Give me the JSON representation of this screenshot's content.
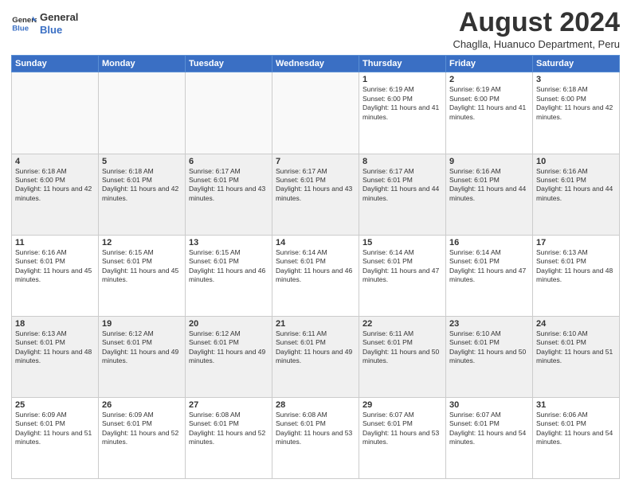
{
  "header": {
    "logo_line1": "General",
    "logo_line2": "Blue",
    "month_title": "August 2024",
    "location": "Chaglla, Huanuco Department, Peru"
  },
  "weekdays": [
    "Sunday",
    "Monday",
    "Tuesday",
    "Wednesday",
    "Thursday",
    "Friday",
    "Saturday"
  ],
  "rows": [
    [
      {
        "day": "",
        "sunrise": "",
        "sunset": "",
        "daylight": ""
      },
      {
        "day": "",
        "sunrise": "",
        "sunset": "",
        "daylight": ""
      },
      {
        "day": "",
        "sunrise": "",
        "sunset": "",
        "daylight": ""
      },
      {
        "day": "",
        "sunrise": "",
        "sunset": "",
        "daylight": ""
      },
      {
        "day": "1",
        "sunrise": "6:19 AM",
        "sunset": "6:00 PM",
        "daylight": "11 hours and 41 minutes."
      },
      {
        "day": "2",
        "sunrise": "6:19 AM",
        "sunset": "6:00 PM",
        "daylight": "11 hours and 41 minutes."
      },
      {
        "day": "3",
        "sunrise": "6:18 AM",
        "sunset": "6:00 PM",
        "daylight": "11 hours and 42 minutes."
      }
    ],
    [
      {
        "day": "4",
        "sunrise": "6:18 AM",
        "sunset": "6:00 PM",
        "daylight": "11 hours and 42 minutes."
      },
      {
        "day": "5",
        "sunrise": "6:18 AM",
        "sunset": "6:01 PM",
        "daylight": "11 hours and 42 minutes."
      },
      {
        "day": "6",
        "sunrise": "6:17 AM",
        "sunset": "6:01 PM",
        "daylight": "11 hours and 43 minutes."
      },
      {
        "day": "7",
        "sunrise": "6:17 AM",
        "sunset": "6:01 PM",
        "daylight": "11 hours and 43 minutes."
      },
      {
        "day": "8",
        "sunrise": "6:17 AM",
        "sunset": "6:01 PM",
        "daylight": "11 hours and 44 minutes."
      },
      {
        "day": "9",
        "sunrise": "6:16 AM",
        "sunset": "6:01 PM",
        "daylight": "11 hours and 44 minutes."
      },
      {
        "day": "10",
        "sunrise": "6:16 AM",
        "sunset": "6:01 PM",
        "daylight": "11 hours and 44 minutes."
      }
    ],
    [
      {
        "day": "11",
        "sunrise": "6:16 AM",
        "sunset": "6:01 PM",
        "daylight": "11 hours and 45 minutes."
      },
      {
        "day": "12",
        "sunrise": "6:15 AM",
        "sunset": "6:01 PM",
        "daylight": "11 hours and 45 minutes."
      },
      {
        "day": "13",
        "sunrise": "6:15 AM",
        "sunset": "6:01 PM",
        "daylight": "11 hours and 46 minutes."
      },
      {
        "day": "14",
        "sunrise": "6:14 AM",
        "sunset": "6:01 PM",
        "daylight": "11 hours and 46 minutes."
      },
      {
        "day": "15",
        "sunrise": "6:14 AM",
        "sunset": "6:01 PM",
        "daylight": "11 hours and 47 minutes."
      },
      {
        "day": "16",
        "sunrise": "6:14 AM",
        "sunset": "6:01 PM",
        "daylight": "11 hours and 47 minutes."
      },
      {
        "day": "17",
        "sunrise": "6:13 AM",
        "sunset": "6:01 PM",
        "daylight": "11 hours and 48 minutes."
      }
    ],
    [
      {
        "day": "18",
        "sunrise": "6:13 AM",
        "sunset": "6:01 PM",
        "daylight": "11 hours and 48 minutes."
      },
      {
        "day": "19",
        "sunrise": "6:12 AM",
        "sunset": "6:01 PM",
        "daylight": "11 hours and 49 minutes."
      },
      {
        "day": "20",
        "sunrise": "6:12 AM",
        "sunset": "6:01 PM",
        "daylight": "11 hours and 49 minutes."
      },
      {
        "day": "21",
        "sunrise": "6:11 AM",
        "sunset": "6:01 PM",
        "daylight": "11 hours and 49 minutes."
      },
      {
        "day": "22",
        "sunrise": "6:11 AM",
        "sunset": "6:01 PM",
        "daylight": "11 hours and 50 minutes."
      },
      {
        "day": "23",
        "sunrise": "6:10 AM",
        "sunset": "6:01 PM",
        "daylight": "11 hours and 50 minutes."
      },
      {
        "day": "24",
        "sunrise": "6:10 AM",
        "sunset": "6:01 PM",
        "daylight": "11 hours and 51 minutes."
      }
    ],
    [
      {
        "day": "25",
        "sunrise": "6:09 AM",
        "sunset": "6:01 PM",
        "daylight": "11 hours and 51 minutes."
      },
      {
        "day": "26",
        "sunrise": "6:09 AM",
        "sunset": "6:01 PM",
        "daylight": "11 hours and 52 minutes."
      },
      {
        "day": "27",
        "sunrise": "6:08 AM",
        "sunset": "6:01 PM",
        "daylight": "11 hours and 52 minutes."
      },
      {
        "day": "28",
        "sunrise": "6:08 AM",
        "sunset": "6:01 PM",
        "daylight": "11 hours and 53 minutes."
      },
      {
        "day": "29",
        "sunrise": "6:07 AM",
        "sunset": "6:01 PM",
        "daylight": "11 hours and 53 minutes."
      },
      {
        "day": "30",
        "sunrise": "6:07 AM",
        "sunset": "6:01 PM",
        "daylight": "11 hours and 54 minutes."
      },
      {
        "day": "31",
        "sunrise": "6:06 AM",
        "sunset": "6:01 PM",
        "daylight": "11 hours and 54 minutes."
      }
    ]
  ]
}
